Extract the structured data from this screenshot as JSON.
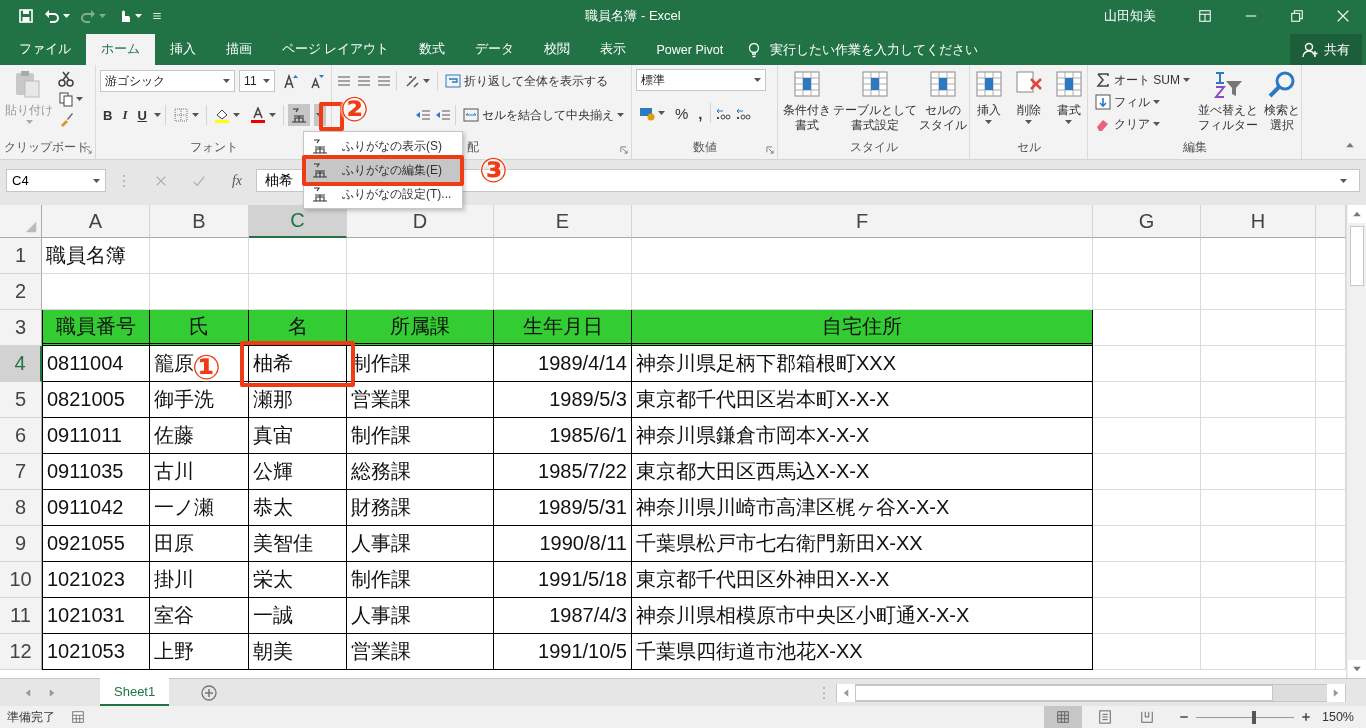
{
  "title_bar": {
    "title": "職員名簿 - Excel",
    "user": "山田知美"
  },
  "ribbon_tabs": [
    {
      "label": "ファイル",
      "selected": false
    },
    {
      "label": "ホーム",
      "selected": true
    },
    {
      "label": "挿入",
      "selected": false
    },
    {
      "label": "描画",
      "selected": false
    },
    {
      "label": "ページ レイアウト",
      "selected": false
    },
    {
      "label": "数式",
      "selected": false
    },
    {
      "label": "データ",
      "selected": false
    },
    {
      "label": "校閲",
      "selected": false
    },
    {
      "label": "表示",
      "selected": false
    },
    {
      "label": "Power Pivot",
      "selected": false
    }
  ],
  "tell_me": {
    "placeholder": "実行したい作業を入力してください"
  },
  "share_button": "共有",
  "ribbon": {
    "clipboard": {
      "paste": "貼り付け",
      "label": "クリップボード"
    },
    "font": {
      "font_name": "游ゴシック",
      "font_size": "11",
      "bold": "B",
      "italic": "I",
      "underline": "U",
      "label": "フォント"
    },
    "alignment": {
      "wrap_text": "折り返して全体を表示する",
      "merge": "セルを結合して中央揃え",
      "label": "配"
    },
    "number": {
      "format": "標準",
      "percent": "%",
      "comma": ",",
      "label": "数値"
    },
    "styles": {
      "buttons": [
        [
          "条件付き",
          "書式"
        ],
        [
          "テーブルとして",
          "書式設定"
        ],
        [
          "セルの",
          "スタイル"
        ]
      ],
      "label": "スタイル"
    },
    "cells": {
      "buttons": [
        "挿入",
        "削除",
        "書式"
      ],
      "label": "セル"
    },
    "editing": {
      "autosum": "オート SUM",
      "fill": "フィル",
      "clear": "クリア",
      "buttons": [
        [
          "並べ替えと",
          "フィルター"
        ],
        [
          "検索と",
          "選択"
        ]
      ],
      "label": "編集"
    }
  },
  "furigana_menu": [
    {
      "label": "ふりがなの表示(S)",
      "selected": false
    },
    {
      "label": "ふりがなの編集(E)",
      "selected": true
    },
    {
      "label": "ふりがなの設定(T)...",
      "selected": false
    }
  ],
  "formula_bar": {
    "name_box": "C4",
    "function_label": "fx",
    "value": "柚希"
  },
  "columns": [
    {
      "label": "A",
      "selected": false
    },
    {
      "label": "B",
      "selected": false
    },
    {
      "label": "C",
      "selected": true
    },
    {
      "label": "D",
      "selected": false
    },
    {
      "label": "E",
      "selected": false
    },
    {
      "label": "F",
      "selected": false
    },
    {
      "label": "G",
      "selected": false
    },
    {
      "label": "H",
      "selected": false
    }
  ],
  "rows": [
    {
      "number": "1",
      "selected": false,
      "kind": "title",
      "cells": [
        "職員名簿",
        "",
        "",
        "",
        "",
        ""
      ]
    },
    {
      "number": "2",
      "selected": false,
      "kind": "blank",
      "cells": [
        "",
        "",
        "",
        "",
        "",
        ""
      ]
    },
    {
      "number": "3",
      "selected": false,
      "kind": "header",
      "cells": [
        "職員番号",
        "氏",
        "名",
        "所属課",
        "生年月日",
        "自宅住所"
      ]
    },
    {
      "number": "4",
      "selected": true,
      "kind": "data",
      "cells": [
        "0811004",
        "籠原",
        "柚希",
        "制作課",
        "1989/4/14",
        "神奈川県足柄下郡箱根町XXX"
      ]
    },
    {
      "number": "5",
      "selected": false,
      "kind": "data",
      "cells": [
        "0821005",
        "御手洗",
        "瀬那",
        "営業課",
        "1989/5/3",
        "東京都千代田区岩本町X-X-X"
      ]
    },
    {
      "number": "6",
      "selected": false,
      "kind": "data",
      "cells": [
        "0911011",
        "佐藤",
        "真宙",
        "制作課",
        "1985/6/1",
        "神奈川県鎌倉市岡本X-X-X"
      ]
    },
    {
      "number": "7",
      "selected": false,
      "kind": "data",
      "cells": [
        "0911035",
        "古川",
        "公輝",
        "総務課",
        "1985/7/22",
        "東京都大田区西馬込X-X-X"
      ]
    },
    {
      "number": "8",
      "selected": false,
      "kind": "data",
      "cells": [
        "0911042",
        "一ノ瀬",
        "恭太",
        "財務課",
        "1989/5/31",
        "神奈川県川崎市高津区梶ヶ谷X-X-X"
      ]
    },
    {
      "number": "9",
      "selected": false,
      "kind": "data",
      "cells": [
        "0921055",
        "田原",
        "美智佳",
        "人事課",
        "1990/8/11",
        "千葉県松戸市七右衛門新田X-XX"
      ]
    },
    {
      "number": "10",
      "selected": false,
      "kind": "data",
      "cells": [
        "1021023",
        "掛川",
        "栄太",
        "制作課",
        "1991/5/18",
        "東京都千代田区外神田X-X-X"
      ]
    },
    {
      "number": "11",
      "selected": false,
      "kind": "data",
      "cells": [
        "1021031",
        "室谷",
        "一誠",
        "人事課",
        "1987/4/3",
        "神奈川県相模原市中央区小町通X-X-X"
      ]
    },
    {
      "number": "12",
      "selected": false,
      "kind": "data",
      "cells": [
        "1021053",
        "上野",
        "朝美",
        "営業課",
        "1991/10/5",
        "千葉県四街道市池花X-XX"
      ]
    }
  ],
  "annotations": [
    {
      "label": "①"
    },
    {
      "label": "②"
    },
    {
      "label": "③"
    }
  ],
  "sheet_tabs": [
    {
      "label": "Sheet1",
      "selected": true
    }
  ],
  "status_bar": {
    "status": "準備完了",
    "zoom": "150%",
    "zoom_slider": {
      "level": 0.59
    }
  }
}
